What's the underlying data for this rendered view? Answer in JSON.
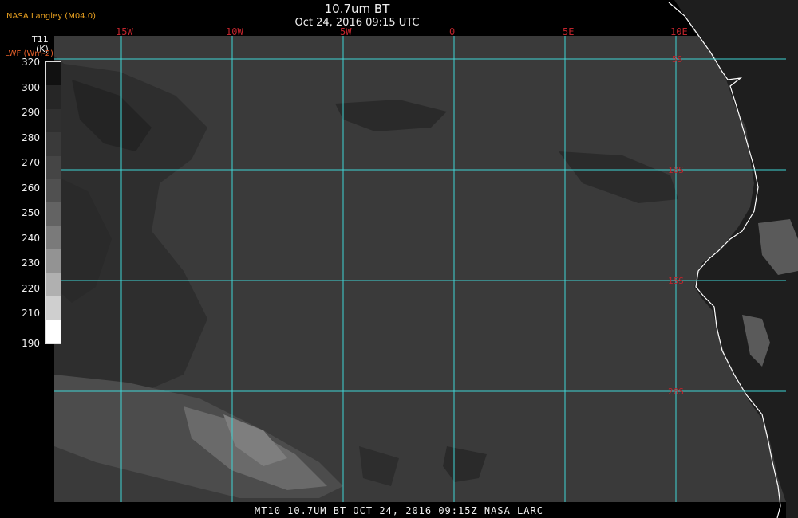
{
  "header": {
    "producer": "NASA Langley (M04.0)",
    "title": "10.7um BT",
    "subtitle": "Oct 24, 2016 09:15 UTC"
  },
  "colorbar": {
    "variable": "T11",
    "unit": "(K)",
    "alt_label": "LWF (Wm-2)",
    "ticks": [
      "320",
      "300",
      "290",
      "280",
      "270",
      "260",
      "250",
      "240",
      "230",
      "220",
      "210",
      "190"
    ],
    "colors": [
      "#111111",
      "#262626",
      "#303030",
      "#3a3a3a",
      "#454545",
      "#505050",
      "#636363",
      "#7a7a7a",
      "#939393",
      "#b0b0b0",
      "#cfcfcf",
      "#ffffff"
    ]
  },
  "map": {
    "longitude_labels": [
      "15W",
      "10W",
      "5W",
      "0",
      "5E",
      "10E"
    ],
    "latitude_labels": [
      "5S",
      "10S",
      "15S",
      "20S"
    ],
    "grid_color": "#3fd4d4",
    "label_color": "#c0242c",
    "ocean_color": "#3a3a3a",
    "land_color": "#1e1e1e",
    "coast_color": "#ffffff"
  },
  "footer": {
    "text": "MT10  10.7UM BT   OCT 24, 2016 09:15Z   NASA LARC"
  }
}
